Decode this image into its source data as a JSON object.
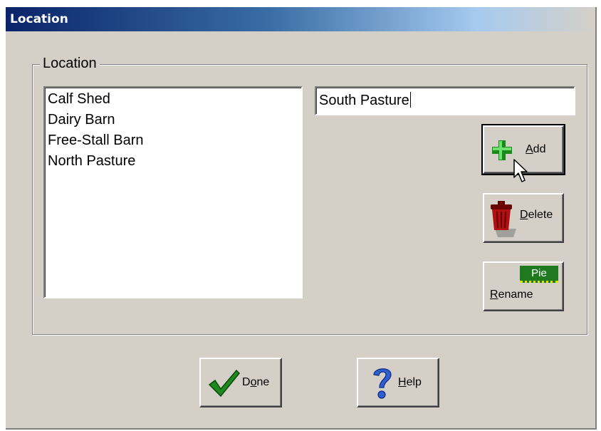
{
  "window": {
    "title": "Location"
  },
  "group": {
    "label": "Location"
  },
  "list": {
    "items": [
      "Calf Shed",
      "Dairy Barn",
      "Free-Stall Barn",
      "North Pasture"
    ]
  },
  "input": {
    "value": "South Pasture"
  },
  "buttons": {
    "add": {
      "mnemonic": "A",
      "rest": "dd"
    },
    "delete": {
      "mnemonic": "D",
      "rest": "elete"
    },
    "rename": {
      "mnemonic": "R",
      "rest": "ename",
      "icon_text": "Pie"
    },
    "done": {
      "pre": "D",
      "mnemonic": "o",
      "rest": "ne"
    },
    "help": {
      "mnemonic": "H",
      "rest": "elp"
    }
  },
  "icons": [
    "plus-icon",
    "trash-can-icon",
    "rename-icon",
    "checkmark-icon",
    "question-mark-icon",
    "mouse-cursor-icon"
  ],
  "colors": {
    "title_start": "#0a246a",
    "title_end": "#a6caf0",
    "face": "#d4d0c8"
  }
}
